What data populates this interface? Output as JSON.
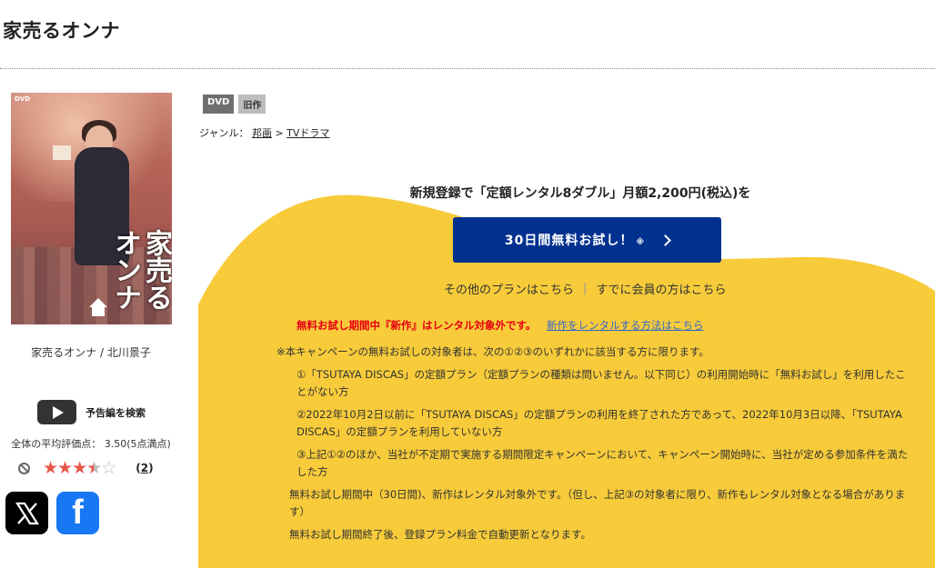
{
  "page": {
    "title": "家売るオンナ"
  },
  "product": {
    "cover_dvd_mark": "DVD",
    "cover_title": "家売るオンナ",
    "caption": "家売るオンナ / 北川景子",
    "badges": [
      "DVD",
      "旧作"
    ]
  },
  "trailer": {
    "label": "予告編を検索",
    "icon": "play-icon"
  },
  "rating": {
    "text": "全体の平均評価点： 3.50(5点満点)",
    "value": 3.5,
    "max": 5,
    "count": "2",
    "count_open": "(",
    "count_close": ")"
  },
  "social": {
    "x_label": "X",
    "facebook_label": "f"
  },
  "genre": {
    "label": "ジャンル：",
    "crumbs": [
      "邦画",
      "TVドラマ"
    ],
    "sep": ">"
  },
  "campaign": {
    "headline": "新規登録で「定額レンタル8ダブル」月額2,200円(税込)を",
    "button_label": "30日間無料お試し！",
    "button_note": "※",
    "other_plans": "その他のプランはこちら",
    "member_link": "すでに会員の方はこちら",
    "link_sep": "|",
    "warning": "無料お試し期間中『新作』はレンタル対象外です。",
    "warning_link": "新作をレンタルする方法はこちら",
    "terms": [
      "※本キャンペーンの無料お試しの対象者は、次の①②③のいずれかに該当する方に限ります。",
      "①「TSUTAYA DISCAS」の定額プラン（定額プランの種類は問いません。以下同じ）の利用開始時に「無料お試し」を利用したことがない方",
      "②2022年10月2日以前に「TSUTAYA DISCAS」の定額プランの利用を終了された方であって、2022年10月3日以降、「TSUTAYA DISCAS」の定額プランを利用していない方",
      "③上記①②のほか、当社が不定期で実施する期間限定キャンペーンにおいて、キャンペーン開始時に、当社が定める参加条件を満たした方",
      "無料お試し期間中（30日間)、新作はレンタル対象外です。（但し、上記③の対象者に限り、新作もレンタル対象となる場合があります）",
      "無料お試し期間終了後、登録プラン料金で自動更新となります。"
    ],
    "colors": {
      "yellow": "#f7cb3a",
      "button": "#00318f",
      "warning": "#e60012"
    }
  }
}
